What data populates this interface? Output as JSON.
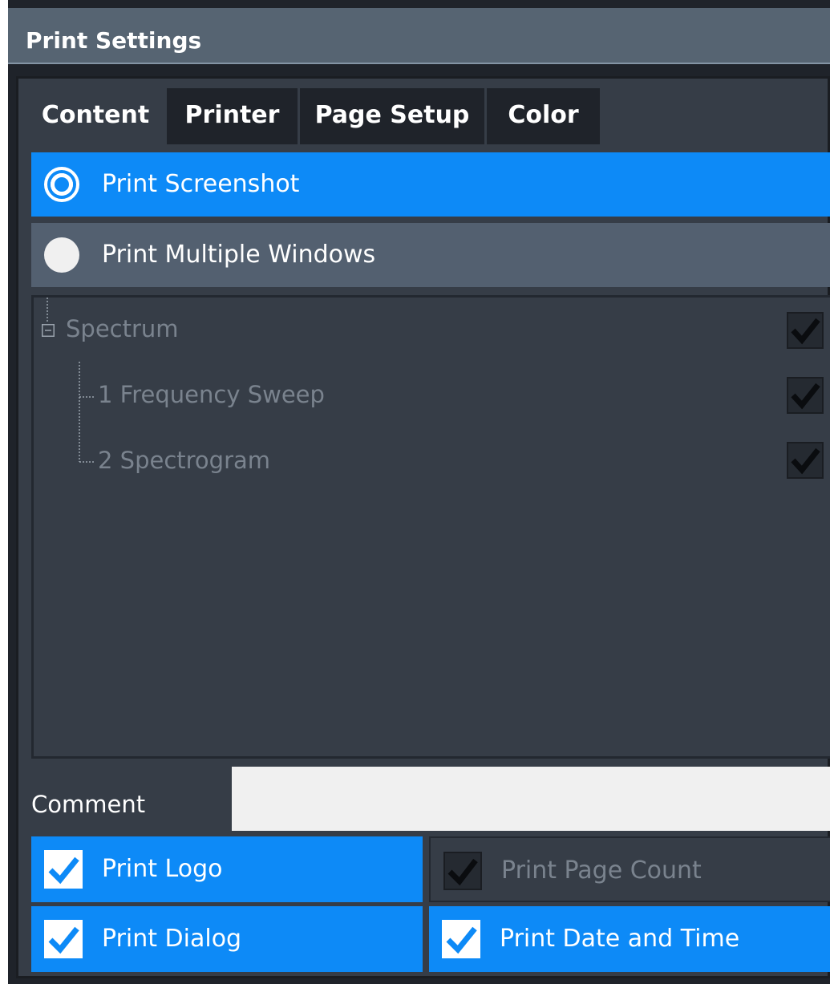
{
  "window": {
    "title": "Print Settings"
  },
  "tabs": [
    {
      "label": "Content",
      "active": true
    },
    {
      "label": "Printer",
      "active": false
    },
    {
      "label": "Page Setup",
      "active": false
    },
    {
      "label": "Color",
      "active": false
    }
  ],
  "content": {
    "print_mode_options": [
      {
        "label": "Print Screenshot",
        "selected": true
      },
      {
        "label": "Print Multiple Windows",
        "selected": false
      }
    ],
    "window_tree": {
      "root": {
        "label": "Spectrum",
        "checked": true,
        "enabled": false
      },
      "children": [
        {
          "label": "1 Frequency Sweep",
          "checked": true,
          "enabled": false
        },
        {
          "label": "2 Spectrogram",
          "checked": true,
          "enabled": false
        }
      ]
    },
    "comment": {
      "label": "Comment",
      "value": ""
    },
    "options": {
      "print_logo": {
        "label": "Print Logo",
        "checked": true,
        "enabled": true
      },
      "print_page_count": {
        "label": "Print Page Count",
        "checked": true,
        "enabled": false
      },
      "print_dialog": {
        "label": "Print Dialog",
        "checked": true,
        "enabled": true
      },
      "print_date_time": {
        "label": "Print Date and Time",
        "checked": true,
        "enabled": true
      }
    }
  },
  "colors": {
    "accent": "#0d8af7",
    "title_bar": "#566472",
    "panel": "#363d47",
    "disabled_text": "#7a838e"
  },
  "icons": {
    "checkmark": "check-icon",
    "tree_collapse": "minus-box-icon",
    "radio": "radio-icon"
  }
}
